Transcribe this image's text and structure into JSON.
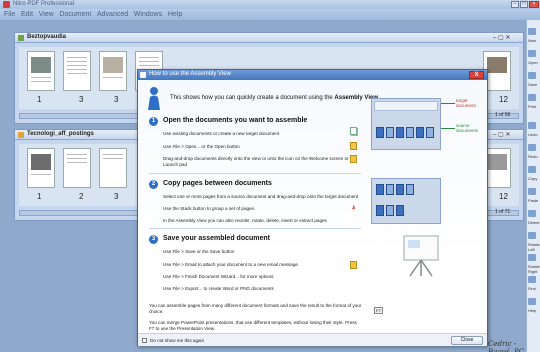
{
  "app": {
    "title": "Nitro PDF Professional",
    "menu": [
      "File",
      "Edit",
      "View",
      "Document",
      "Advanced",
      "Windows",
      "Help"
    ]
  },
  "panels": [
    {
      "name": "Beztopvaudia",
      "pages": [
        "1",
        "3",
        "3",
        "12"
      ],
      "page_count": "1 of 56"
    },
    {
      "name": "Tecnologi_aff_postings",
      "pages": [
        "1",
        "2",
        "3",
        "12"
      ],
      "page_count": "1 of 71"
    }
  ],
  "right_strip": [
    "New",
    "Open",
    "Save",
    "Print",
    "Undo",
    "Redo",
    "Copy",
    "Paste",
    "Delete",
    "Rotate Left",
    "Rotate Right",
    "Find",
    "Help"
  ],
  "dialog": {
    "title": "How to use the Assembly View",
    "close_label": "X",
    "intro_prefix": "This shows how you can quickly create a document using the ",
    "intro_bold": "Assembly View",
    "steps": [
      {
        "number": "1",
        "title": "Open the documents you want to assemble",
        "lines": [
          "Use existing documents or create a new target document",
          "Use File > Open... or the Open button",
          "Drag-and-drop documents directly onto the view or onto the icon on the Welcome screen or",
          "Launch pad"
        ]
      },
      {
        "number": "2",
        "title": "Copy pages between documents",
        "lines": [
          "Select one or more pages from a source document and drag-and-drop onto the target document",
          "Use the Stack button to group a set of pages",
          "In the Assembly View you can also reorder, rotate, delete, insert or extract pages"
        ]
      },
      {
        "number": "3",
        "title": "Save your assembled document",
        "lines": [
          "Use File > Save or the Save button",
          "Use File > Email to attach your document to a new email message",
          "Use File > Finish Document Wizard... for more options",
          "Use File > Export... to create Word or PNG documents"
        ]
      }
    ],
    "labels": {
      "target": "target\ndocument",
      "source": "source\ndocuments"
    },
    "footer_notes": [
      "You can assemble pages from many different document formats and save the result to the format of your",
      "choice.",
      "You can merge PowerPoint presentations, that use different templates, without losing their style. Press",
      "F7 to use the Presentation View."
    ],
    "checkbox_label": "Do not show me this again",
    "close_button": "Close"
  },
  "watermark": "Cedric - Bagoš, PC",
  "colors": {
    "accent": "#2d6fc4",
    "target": "#c0392b",
    "source": "#2f8a3b"
  }
}
